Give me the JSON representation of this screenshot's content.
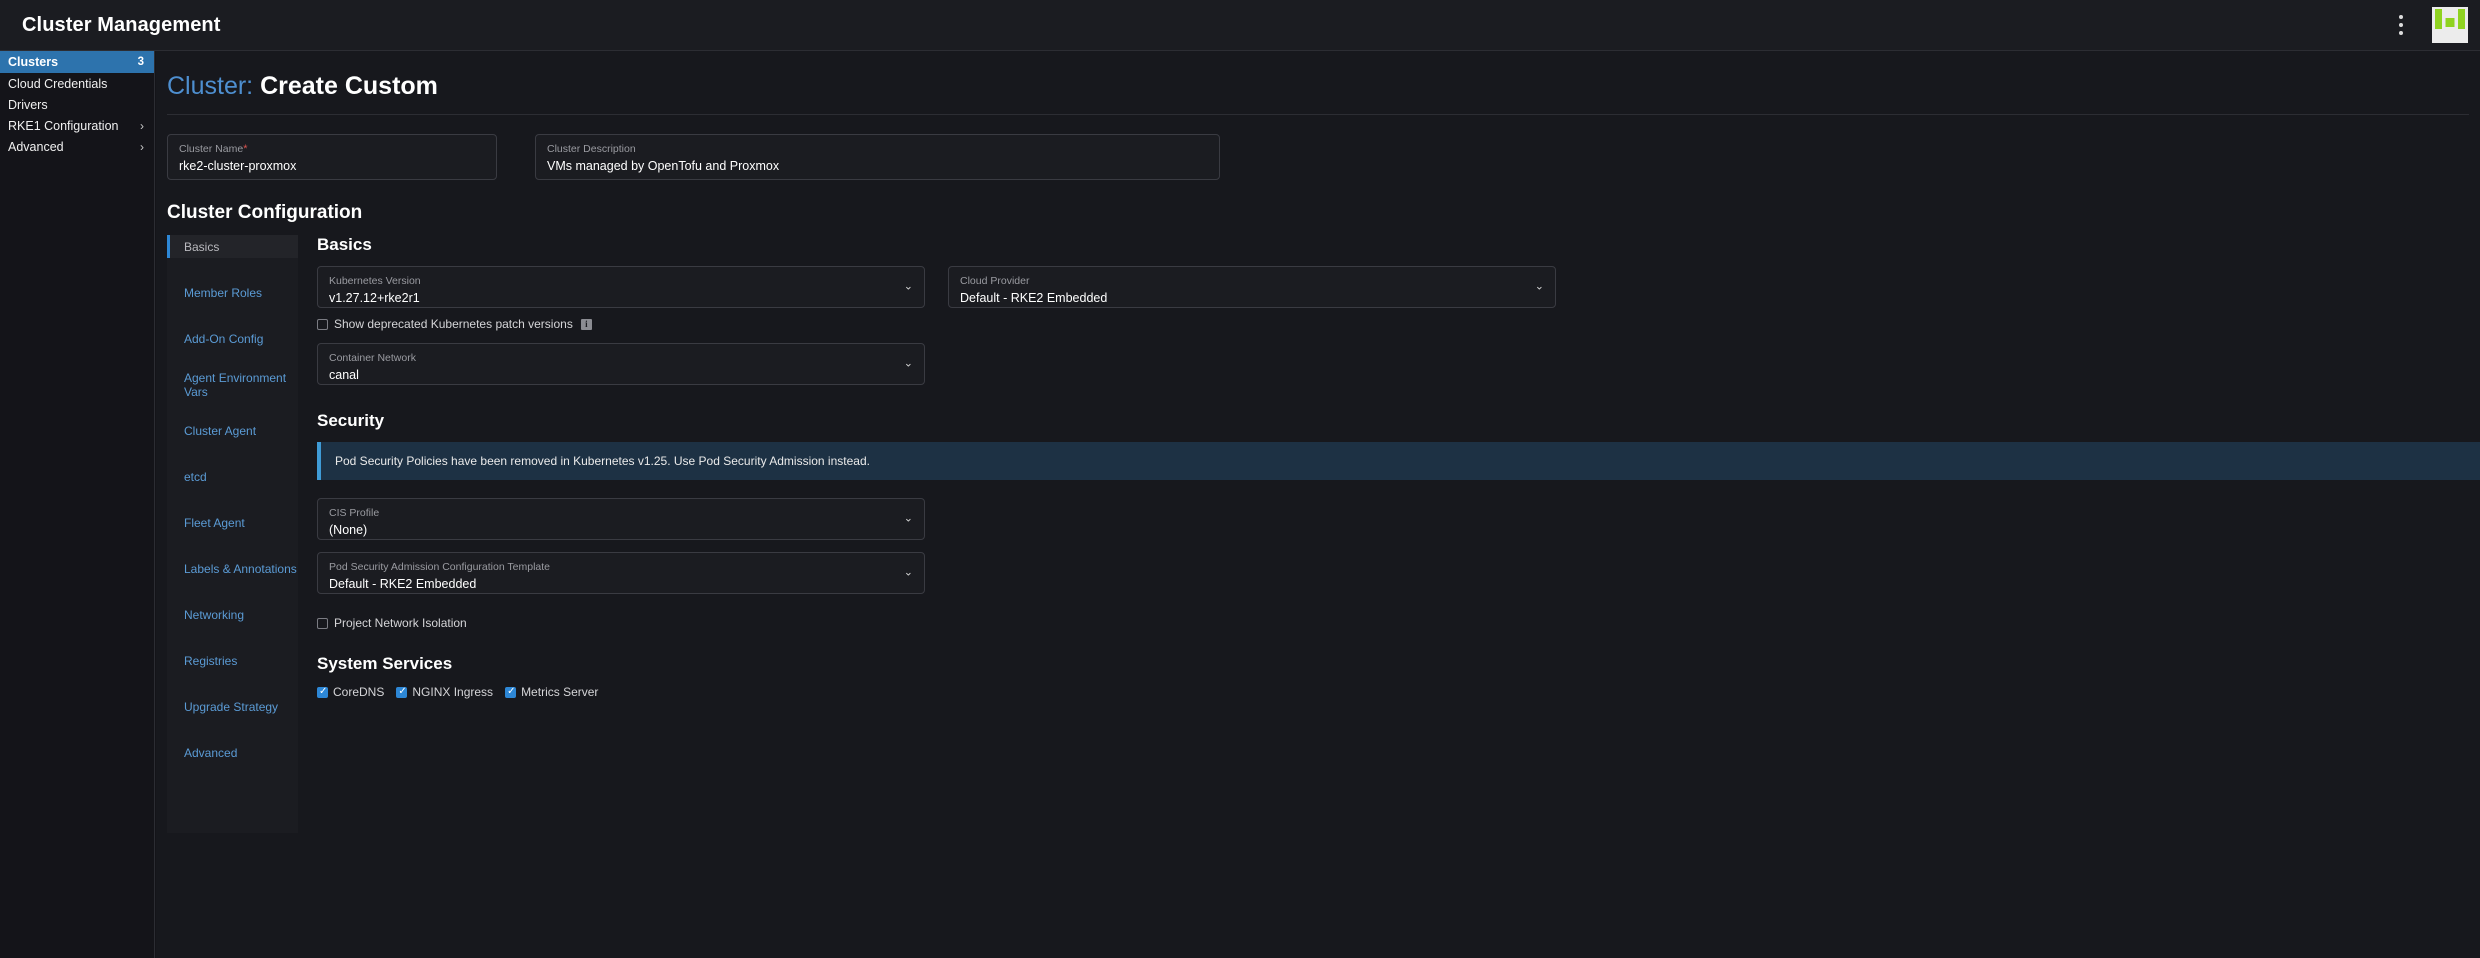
{
  "topbar": {
    "title": "Cluster Management",
    "kebab_label": "⋮",
    "logo_label": "rancher-logo"
  },
  "sidebar": {
    "items": [
      {
        "label": "Clusters",
        "count": "3",
        "active": true,
        "chevron": ""
      },
      {
        "label": "Cloud Credentials",
        "count": "",
        "active": false,
        "chevron": ""
      },
      {
        "label": "Drivers",
        "count": "",
        "active": false,
        "chevron": ""
      },
      {
        "label": "RKE1 Configuration",
        "count": "",
        "active": false,
        "chevron": "›"
      },
      {
        "label": "Advanced",
        "count": "",
        "active": false,
        "chevron": "›"
      }
    ]
  },
  "page": {
    "title_prefix": "Cluster:",
    "title_name": "Create Custom"
  },
  "cluster_name": {
    "label": "Cluster Name",
    "required_mark": "*",
    "value": "rke2-cluster-proxmox"
  },
  "cluster_description": {
    "label": "Cluster Description",
    "value": "VMs managed by OpenTofu and Proxmox"
  },
  "config": {
    "heading": "Cluster Configuration",
    "tabs": [
      {
        "label": "Basics",
        "active": true
      },
      {
        "label": "Member Roles",
        "active": false
      },
      {
        "label": "Add-On Config",
        "active": false
      },
      {
        "label": "Agent Environment Vars",
        "active": false
      },
      {
        "label": "Cluster Agent",
        "active": false
      },
      {
        "label": "etcd",
        "active": false
      },
      {
        "label": "Fleet Agent",
        "active": false
      },
      {
        "label": "Labels & Annotations",
        "active": false
      },
      {
        "label": "Networking",
        "active": false
      },
      {
        "label": "Registries",
        "active": false
      },
      {
        "label": "Upgrade Strategy",
        "active": false
      },
      {
        "label": "Advanced",
        "active": false
      }
    ]
  },
  "basics": {
    "heading": "Basics",
    "kubernetes_version": {
      "label": "Kubernetes Version",
      "value": "v1.27.12+rke2r1",
      "caret": "⌄"
    },
    "cloud_provider": {
      "label": "Cloud Provider",
      "value": "Default - RKE2 Embedded",
      "caret": "⌄"
    },
    "show_deprecated": {
      "label": "Show deprecated Kubernetes patch versions",
      "checked": false,
      "info": "i"
    },
    "container_network": {
      "label": "Container Network",
      "value": "canal",
      "caret": "⌄"
    }
  },
  "security": {
    "heading": "Security",
    "banner": "Pod Security Policies have been removed in Kubernetes v1.25. Use Pod Security Admission instead.",
    "cis_profile": {
      "label": "CIS Profile",
      "value": "(None)",
      "caret": "⌄"
    },
    "psact": {
      "label": "Pod Security Admission Configuration Template",
      "value": "Default - RKE2 Embedded",
      "caret": "⌄"
    },
    "project_network_isolation": {
      "label": "Project Network Isolation",
      "checked": false
    }
  },
  "system_services": {
    "heading": "System Services",
    "items": [
      {
        "label": "CoreDNS",
        "checked": true
      },
      {
        "label": "NGINX Ingress",
        "checked": true
      },
      {
        "label": "Metrics Server",
        "checked": true
      }
    ]
  },
  "colors": {
    "accent_blue": "#2d73ad",
    "link_blue": "#5b9bd5",
    "title_blue": "#4e8fd0",
    "checkbox_blue": "#2d87d6",
    "banner_bg": "#1d3144",
    "logo_green": "#8fd320",
    "required_red": "#d9534f"
  }
}
